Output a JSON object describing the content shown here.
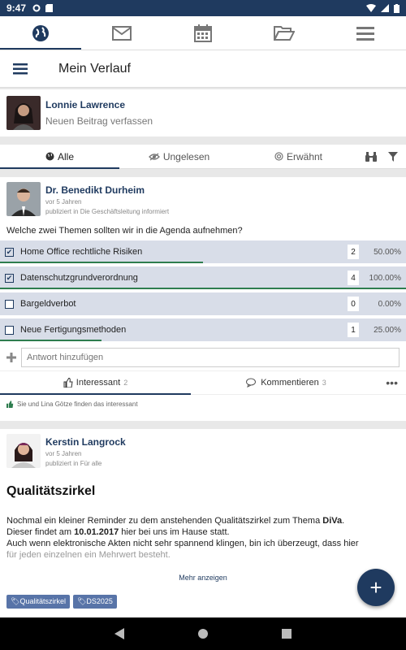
{
  "statusbar": {
    "time": "9:47"
  },
  "header": {
    "title": "Mein Verlauf"
  },
  "composer": {
    "name": "Lonnie Lawrence",
    "placeholder": "Neuen Beitrag verfassen"
  },
  "filter": {
    "tabs": [
      "Alle",
      "Ungelesen",
      "Erwähnt"
    ]
  },
  "post1": {
    "author": "Dr. Benedikt Durheim",
    "ago": "vor 5 Jahren",
    "published": "publiziert in Die Geschäftsleitung informiert",
    "question": "Welche zwei Themen sollten wir in die Agenda aufnehmen?",
    "options": [
      {
        "label": "Home Office rechtliche Risiken",
        "count": "2",
        "pct": "50.00%",
        "checked": true,
        "fraction": 0.5
      },
      {
        "label": "Datenschutzgrundverordnung",
        "count": "4",
        "pct": "100.00%",
        "checked": true,
        "fraction": 1.0
      },
      {
        "label": "Bargeldverbot",
        "count": "0",
        "pct": "0.00%",
        "checked": false,
        "fraction": 0.0
      },
      {
        "label": "Neue Fertigungsmethoden",
        "count": "1",
        "pct": "25.00%",
        "checked": false,
        "fraction": 0.25
      }
    ],
    "reply_placeholder": "Antwort hinzufügen",
    "interesting_label": "Interessant",
    "interesting_count": "2",
    "comment_label": "Kommentieren",
    "comment_count": "3",
    "likes_text": "Sie und Lina Götze finden das interessant"
  },
  "post2": {
    "author": "Kerstin Langrock",
    "ago": "vor 5 Jahren",
    "published": "publiziert in Für alle",
    "title": "Qualitätszirkel",
    "line1a": "Nochmal ein kleiner Reminder zu dem anstehenden Qualitätszirkel zum Thema ",
    "line1b": "DiVa",
    "line1c": ".",
    "line2a": "Dieser findet am ",
    "line2b": "10.01.2017",
    "line2c": " hier bei uns im Hause statt.",
    "line3": "Auch wenn elektronische Akten nicht sehr spannend klingen, bin ich überzeugt, dass hier",
    "line4": "für jeden einzelnen ein Mehrwert besteht.",
    "more": "Mehr anzeigen",
    "tags": [
      "Qualitätszirkel",
      "DS2025"
    ]
  },
  "fab": {
    "label": "+"
  },
  "colors": {
    "primary": "#1f3a5f",
    "poll_bg": "#d8dde8",
    "bar": "#2e7d4f",
    "tag": "#5874a8"
  }
}
